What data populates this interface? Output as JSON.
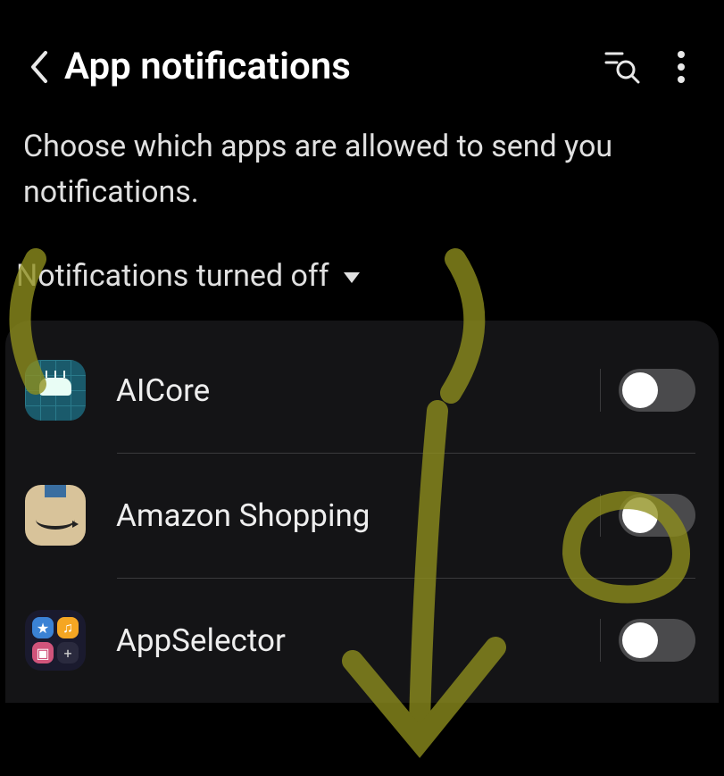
{
  "header": {
    "title": "App notifications"
  },
  "description": "Choose which apps are allowed to send you notifications.",
  "filter": {
    "label": "Notifications turned off"
  },
  "apps": [
    {
      "name": "AICore",
      "enabled": false
    },
    {
      "name": "Amazon Shopping",
      "enabled": false
    },
    {
      "name": "AppSelector",
      "enabled": false
    }
  ]
}
